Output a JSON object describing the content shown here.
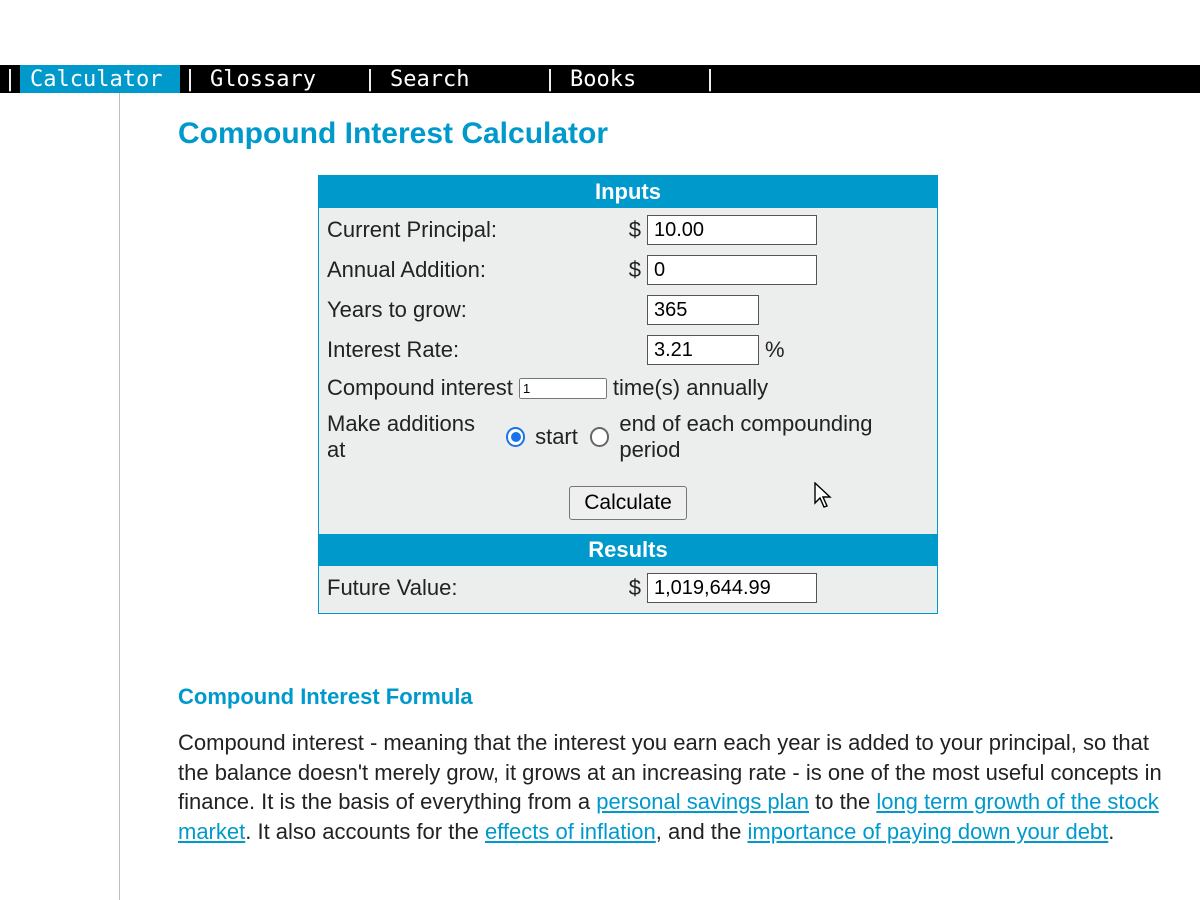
{
  "nav": {
    "items": [
      {
        "label": "Calculator",
        "active": true
      },
      {
        "label": "Glossary",
        "active": false
      },
      {
        "label": "Search",
        "active": false
      },
      {
        "label": "Books",
        "active": false
      }
    ]
  },
  "page": {
    "title": "Compound Interest Calculator"
  },
  "calc": {
    "inputs_header": "Inputs",
    "results_header": "Results",
    "labels": {
      "principal": "Current Principal:",
      "addition": "Annual Addition:",
      "years": "Years to grow:",
      "rate": "Interest Rate:",
      "compound_prefix": "Compound interest",
      "compound_suffix": "time(s) annually",
      "additions_prefix": "Make additions at",
      "start": "start",
      "end_suffix": "end of each compounding period",
      "future_value": "Future Value:",
      "dollar": "$",
      "percent": "%"
    },
    "values": {
      "principal": "10.00",
      "addition": "0",
      "years": "365",
      "rate": "3.21",
      "compound_times": "1",
      "addition_timing": "start",
      "future_value": "1,019,644.99"
    },
    "button": "Calculate"
  },
  "formula": {
    "heading": "Compound Interest Formula",
    "p1_a": "Compound interest - meaning that the interest you earn each year is added to your principal, so that the balance doesn't merely grow, it grows at an increasing rate - is one of the most useful concepts in finance. It is the basis of everything from a ",
    "link1": "personal savings plan",
    "p1_b": " to the ",
    "link2": "long term growth of the stock market",
    "p1_c": ". It also accounts for the ",
    "link3": "effects of inflation",
    "p1_d": ", and the ",
    "link4": "importance of paying down your debt",
    "p1_e": "."
  }
}
